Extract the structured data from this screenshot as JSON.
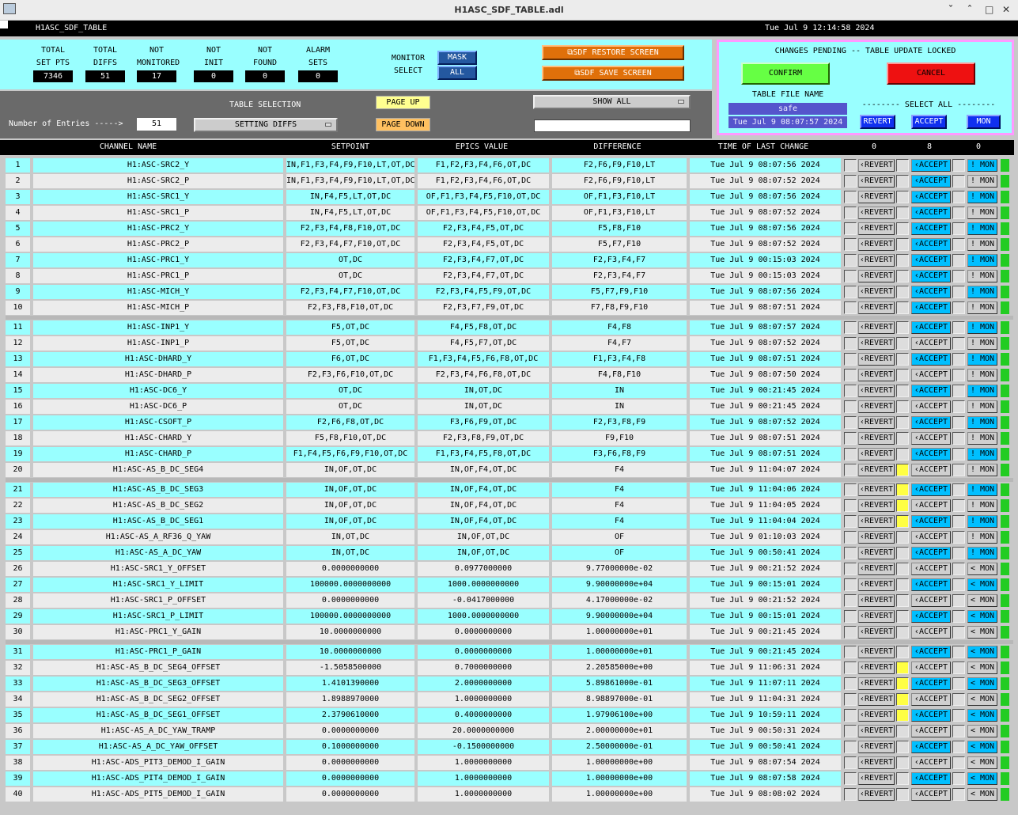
{
  "window": {
    "title": "H1ASC_SDF_TABLE.adl",
    "buttons": {
      "minimize": "ˇ",
      "maximize": "ˆ",
      "restore": "□",
      "close": "✕"
    }
  },
  "header": {
    "name": "H1ASC_SDF_TABLE",
    "datetime": "Tue Jul  9 12:14:58 2024"
  },
  "stats": [
    {
      "label1": "TOTAL",
      "label2": "SET PTS",
      "value": "7346"
    },
    {
      "label1": "TOTAL",
      "label2": "DIFFS",
      "value": "51"
    },
    {
      "label1": "NOT",
      "label2": "MONITORED",
      "value": "17"
    },
    {
      "label1": "NOT",
      "label2": "INIT",
      "value": "0"
    },
    {
      "label1": "NOT",
      "label2": "FOUND",
      "value": "0"
    },
    {
      "label1": "ALARM",
      "label2": "SETS",
      "value": "0"
    }
  ],
  "monitor": {
    "label1": "MONITOR",
    "label2": "SELECT",
    "mask": "MASK",
    "all": "ALL"
  },
  "screen_buttons": {
    "restore": "SDF RESTORE SCREEN",
    "save": "SDF SAVE SCREEN"
  },
  "table_selection": {
    "heading": "TABLE SELECTION",
    "entries_label": "Number of Entries ----->",
    "entries_value": "51",
    "selected": "SETTING DIFFS",
    "page_up": "PAGE UP",
    "page_down": "PAGE DOWN",
    "show": "SHOW ALL",
    "filter_value": ""
  },
  "pending": {
    "title": "CHANGES PENDING -- TABLE UPDATE LOCKED",
    "confirm": "CONFIRM",
    "cancel": "CANCEL",
    "file_label": "TABLE FILE NAME",
    "file_value": "safe",
    "file_time": "Tue Jul  9 08:07:57 2024",
    "select_all": "-------- SELECT ALL --------",
    "revert": "REVERT",
    "accept": "ACCEPT",
    "mon": "MON"
  },
  "columns": {
    "channel": "CHANNEL NAME",
    "setpoint": "SETPOINT",
    "epics": "EPICS VALUE",
    "diff": "DIFFERENCE",
    "time": "TIME OF LAST CHANGE",
    "revert_count": "0",
    "accept_count": "8",
    "mon_count": "0"
  },
  "row_labels": {
    "revert": "REVERT",
    "accept": "ACCEPT",
    "mon": "MON",
    "revert_icon": "‹",
    "accept_icon": "‹",
    "mon_icon": "!",
    "mon_icon_alt": "<"
  },
  "colors": {
    "cyan": "#9ff",
    "yellow": "#ff4",
    "green": "#2c2",
    "accept_blue": "#00bfff",
    "confirm": "#6f4",
    "cancel": "#e11"
  },
  "rows": [
    {
      "n": "1",
      "name": "H1:ASC-SRC2_Y",
      "set": "IN,F1,F3,F4,F9,F10,LT,OT,DC",
      "epics": "F1,F2,F3,F4,F6,OT,DC",
      "diff": "F2,F6,F9,F10,LT",
      "time": "Tue Jul  9 08:07:56 2024",
      "acc": true,
      "mon": "!",
      "monb": true
    },
    {
      "n": "2",
      "name": "H1:ASC-SRC2_P",
      "set": "IN,F1,F3,F4,F9,F10,LT,OT,DC",
      "epics": "F1,F2,F3,F4,F6,OT,DC",
      "diff": "F2,F6,F9,F10,LT",
      "time": "Tue Jul  9 08:07:52 2024",
      "acc": true,
      "mon": "!",
      "monb": false
    },
    {
      "n": "3",
      "name": "H1:ASC-SRC1_Y",
      "set": "IN,F4,F5,LT,OT,DC",
      "epics": "OF,F1,F3,F4,F5,F10,OT,DC",
      "diff": "OF,F1,F3,F10,LT",
      "time": "Tue Jul  9 08:07:56 2024",
      "acc": true,
      "mon": "!",
      "monb": true
    },
    {
      "n": "4",
      "name": "H1:ASC-SRC1_P",
      "set": "IN,F4,F5,LT,OT,DC",
      "epics": "OF,F1,F3,F4,F5,F10,OT,DC",
      "diff": "OF,F1,F3,F10,LT",
      "time": "Tue Jul  9 08:07:52 2024",
      "acc": true,
      "mon": "!",
      "monb": false
    },
    {
      "n": "5",
      "name": "H1:ASC-PRC2_Y",
      "set": "F2,F3,F4,F8,F10,OT,DC",
      "epics": "F2,F3,F4,F5,OT,DC",
      "diff": "F5,F8,F10",
      "time": "Tue Jul  9 08:07:56 2024",
      "acc": true,
      "mon": "!",
      "monb": true
    },
    {
      "n": "6",
      "name": "H1:ASC-PRC2_P",
      "set": "F2,F3,F4,F7,F10,OT,DC",
      "epics": "F2,F3,F4,F5,OT,DC",
      "diff": "F5,F7,F10",
      "time": "Tue Jul  9 08:07:52 2024",
      "acc": true,
      "mon": "!",
      "monb": false
    },
    {
      "n": "7",
      "name": "H1:ASC-PRC1_Y",
      "set": "OT,DC",
      "epics": "F2,F3,F4,F7,OT,DC",
      "diff": "F2,F3,F4,F7",
      "time": "Tue Jul  9 00:15:03 2024",
      "acc": true,
      "mon": "!",
      "monb": true
    },
    {
      "n": "8",
      "name": "H1:ASC-PRC1_P",
      "set": "OT,DC",
      "epics": "F2,F3,F4,F7,OT,DC",
      "diff": "F2,F3,F4,F7",
      "time": "Tue Jul  9 00:15:03 2024",
      "acc": true,
      "mon": "!",
      "monb": false
    },
    {
      "n": "9",
      "name": "H1:ASC-MICH_Y",
      "set": "F2,F3,F4,F7,F10,OT,DC",
      "epics": "F2,F3,F4,F5,F9,OT,DC",
      "diff": "F5,F7,F9,F10",
      "time": "Tue Jul  9 08:07:56 2024",
      "acc": true,
      "mon": "!",
      "monb": true
    },
    {
      "n": "10",
      "name": "H1:ASC-MICH_P",
      "set": "F2,F3,F8,F10,OT,DC",
      "epics": "F2,F3,F7,F9,OT,DC",
      "diff": "F7,F8,F9,F10",
      "time": "Tue Jul  9 08:07:51 2024",
      "acc": true,
      "mon": "!",
      "monb": false
    },
    {
      "n": "11",
      "name": "H1:ASC-INP1_Y",
      "set": "F5,OT,DC",
      "epics": "F4,F5,F8,OT,DC",
      "diff": "F4,F8",
      "time": "Tue Jul  9 08:07:57 2024",
      "acc": true,
      "mon": "!",
      "monb": true
    },
    {
      "n": "12",
      "name": "H1:ASC-INP1_P",
      "set": "F5,OT,DC",
      "epics": "F4,F5,F7,OT,DC",
      "diff": "F4,F7",
      "time": "Tue Jul  9 08:07:52 2024",
      "acc": false,
      "mon": "!",
      "monb": false
    },
    {
      "n": "13",
      "name": "H1:ASC-DHARD_Y",
      "set": "F6,OT,DC",
      "epics": "F1,F3,F4,F5,F6,F8,OT,DC",
      "diff": "F1,F3,F4,F8",
      "time": "Tue Jul  9 08:07:51 2024",
      "acc": true,
      "mon": "!",
      "monb": true
    },
    {
      "n": "14",
      "name": "H1:ASC-DHARD_P",
      "set": "F2,F3,F6,F10,OT,DC",
      "epics": "F2,F3,F4,F6,F8,OT,DC",
      "diff": "F4,F8,F10",
      "time": "Tue Jul  9 08:07:50 2024",
      "acc": false,
      "mon": "!",
      "monb": false
    },
    {
      "n": "15",
      "name": "H1:ASC-DC6_Y",
      "set": "OT,DC",
      "epics": "IN,OT,DC",
      "diff": "IN",
      "time": "Tue Jul  9 00:21:45 2024",
      "acc": true,
      "mon": "!",
      "monb": true
    },
    {
      "n": "16",
      "name": "H1:ASC-DC6_P",
      "set": "OT,DC",
      "epics": "IN,OT,DC",
      "diff": "IN",
      "time": "Tue Jul  9 00:21:45 2024",
      "acc": false,
      "mon": "!",
      "monb": false
    },
    {
      "n": "17",
      "name": "H1:ASC-CSOFT_P",
      "set": "F2,F6,F8,OT,DC",
      "epics": "F3,F6,F9,OT,DC",
      "diff": "F2,F3,F8,F9",
      "time": "Tue Jul  9 08:07:52 2024",
      "acc": true,
      "mon": "!",
      "monb": true
    },
    {
      "n": "18",
      "name": "H1:ASC-CHARD_Y",
      "set": "F5,F8,F10,OT,DC",
      "epics": "F2,F3,F8,F9,OT,DC",
      "diff": "F9,F10",
      "time": "Tue Jul  9 08:07:51 2024",
      "acc": false,
      "mon": "!",
      "monb": false
    },
    {
      "n": "19",
      "name": "H1:ASC-CHARD_P",
      "set": "F1,F4,F5,F6,F9,F10,OT,DC",
      "epics": "F1,F3,F4,F5,F8,OT,DC",
      "diff": "F3,F6,F8,F9",
      "time": "Tue Jul  9 08:07:51 2024",
      "acc": true,
      "mon": "!",
      "monb": true
    },
    {
      "n": "20",
      "name": "H1:ASC-AS_B_DC_SEG4",
      "set": "IN,OF,OT,DC",
      "epics": "IN,OF,F4,OT,DC",
      "diff": "F4",
      "time": "Tue Jul  9 11:04:07 2024",
      "acc": false,
      "mon": "!",
      "monb": false,
      "y": true
    },
    {
      "n": "21",
      "name": "H1:ASC-AS_B_DC_SEG3",
      "set": "IN,OF,OT,DC",
      "epics": "IN,OF,F4,OT,DC",
      "diff": "F4",
      "time": "Tue Jul  9 11:04:06 2024",
      "acc": true,
      "mon": "!",
      "monb": true,
      "y": true
    },
    {
      "n": "22",
      "name": "H1:ASC-AS_B_DC_SEG2",
      "set": "IN,OF,OT,DC",
      "epics": "IN,OF,F4,OT,DC",
      "diff": "F4",
      "time": "Tue Jul  9 11:04:05 2024",
      "acc": false,
      "mon": "!",
      "monb": false,
      "y": true
    },
    {
      "n": "23",
      "name": "H1:ASC-AS_B_DC_SEG1",
      "set": "IN,OF,OT,DC",
      "epics": "IN,OF,F4,OT,DC",
      "diff": "F4",
      "time": "Tue Jul  9 11:04:04 2024",
      "acc": true,
      "mon": "!",
      "monb": true,
      "y": true
    },
    {
      "n": "24",
      "name": "H1:ASC-AS_A_RF36_Q_YAW",
      "set": "IN,OT,DC",
      "epics": "IN,OF,OT,DC",
      "diff": "OF",
      "time": "Tue Jul  9 01:10:03 2024",
      "acc": false,
      "mon": "!",
      "monb": false
    },
    {
      "n": "25",
      "name": "H1:ASC-AS_A_DC_YAW",
      "set": "IN,OT,DC",
      "epics": "IN,OF,OT,DC",
      "diff": "OF",
      "time": "Tue Jul  9 00:50:41 2024",
      "acc": true,
      "mon": "!",
      "monb": true
    },
    {
      "n": "26",
      "name": "H1:ASC-SRC1_Y_OFFSET",
      "set": "0.0000000000",
      "epics": "0.0977000000",
      "diff": "9.77000000e-02",
      "time": "Tue Jul  9 00:21:52 2024",
      "acc": false,
      "mon": "<",
      "monb": false
    },
    {
      "n": "27",
      "name": "H1:ASC-SRC1_Y_LIMIT",
      "set": "100000.0000000000",
      "epics": "1000.0000000000",
      "diff": "9.90000000e+04",
      "time": "Tue Jul  9 00:15:01 2024",
      "acc": true,
      "mon": "<",
      "monb": true
    },
    {
      "n": "28",
      "name": "H1:ASC-SRC1_P_OFFSET",
      "set": "0.0000000000",
      "epics": "-0.0417000000",
      "diff": "4.17000000e-02",
      "time": "Tue Jul  9 00:21:52 2024",
      "acc": false,
      "mon": "<",
      "monb": false
    },
    {
      "n": "29",
      "name": "H1:ASC-SRC1_P_LIMIT",
      "set": "100000.0000000000",
      "epics": "1000.0000000000",
      "diff": "9.90000000e+04",
      "time": "Tue Jul  9 00:15:01 2024",
      "acc": true,
      "mon": "<",
      "monb": true
    },
    {
      "n": "30",
      "name": "H1:ASC-PRC1_Y_GAIN",
      "set": "10.0000000000",
      "epics": "0.0000000000",
      "diff": "1.00000000e+01",
      "time": "Tue Jul  9 00:21:45 2024",
      "acc": false,
      "mon": "<",
      "monb": false
    },
    {
      "n": "31",
      "name": "H1:ASC-PRC1_P_GAIN",
      "set": "10.0000000000",
      "epics": "0.0000000000",
      "diff": "1.00000000e+01",
      "time": "Tue Jul  9 00:21:45 2024",
      "acc": true,
      "mon": "<",
      "monb": true
    },
    {
      "n": "32",
      "name": "H1:ASC-AS_B_DC_SEG4_OFFSET",
      "set": "-1.5058500000",
      "epics": "0.7000000000",
      "diff": "2.20585000e+00",
      "time": "Tue Jul  9 11:06:31 2024",
      "acc": false,
      "mon": "<",
      "monb": false,
      "y": true
    },
    {
      "n": "33",
      "name": "H1:ASC-AS_B_DC_SEG3_OFFSET",
      "set": "1.4101390000",
      "epics": "2.0000000000",
      "diff": "5.89861000e-01",
      "time": "Tue Jul  9 11:07:11 2024",
      "acc": true,
      "mon": "<",
      "monb": true,
      "y": true
    },
    {
      "n": "34",
      "name": "H1:ASC-AS_B_DC_SEG2_OFFSET",
      "set": "1.8988970000",
      "epics": "1.0000000000",
      "diff": "8.98897000e-01",
      "time": "Tue Jul  9 11:04:31 2024",
      "acc": false,
      "mon": "<",
      "monb": false,
      "y": true
    },
    {
      "n": "35",
      "name": "H1:ASC-AS_B_DC_SEG1_OFFSET",
      "set": "2.3790610000",
      "epics": "0.4000000000",
      "diff": "1.97906100e+00",
      "time": "Tue Jul  9 10:59:11 2024",
      "acc": true,
      "mon": "<",
      "monb": true,
      "y": true
    },
    {
      "n": "36",
      "name": "H1:ASC-AS_A_DC_YAW_TRAMP",
      "set": "0.0000000000",
      "epics": "20.0000000000",
      "diff": "2.00000000e+01",
      "time": "Tue Jul  9 00:50:31 2024",
      "acc": false,
      "mon": "<",
      "monb": false
    },
    {
      "n": "37",
      "name": "H1:ASC-AS_A_DC_YAW_OFFSET",
      "set": "0.1000000000",
      "epics": "-0.1500000000",
      "diff": "2.50000000e-01",
      "time": "Tue Jul  9 00:50:41 2024",
      "acc": true,
      "mon": "<",
      "monb": true
    },
    {
      "n": "38",
      "name": "H1:ASC-ADS_PIT3_DEMOD_I_GAIN",
      "set": "0.0000000000",
      "epics": "1.0000000000",
      "diff": "1.00000000e+00",
      "time": "Tue Jul  9 08:07:54 2024",
      "acc": false,
      "mon": "<",
      "monb": false
    },
    {
      "n": "39",
      "name": "H1:ASC-ADS_PIT4_DEMOD_I_GAIN",
      "set": "0.0000000000",
      "epics": "1.0000000000",
      "diff": "1.00000000e+00",
      "time": "Tue Jul  9 08:07:58 2024",
      "acc": true,
      "mon": "<",
      "monb": true
    },
    {
      "n": "40",
      "name": "H1:ASC-ADS_PIT5_DEMOD_I_GAIN",
      "set": "0.0000000000",
      "epics": "1.0000000000",
      "diff": "1.00000000e+00",
      "time": "Tue Jul  9 08:08:02 2024",
      "acc": false,
      "mon": "<",
      "monb": false
    }
  ]
}
